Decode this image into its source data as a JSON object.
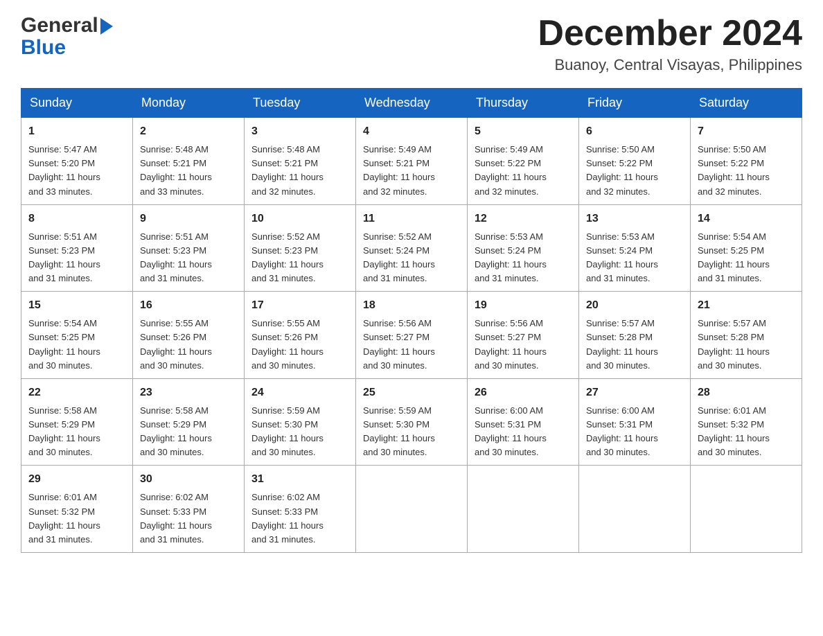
{
  "header": {
    "logo_general": "General",
    "logo_blue": "Blue",
    "month_title": "December 2024",
    "location": "Buanoy, Central Visayas, Philippines"
  },
  "weekdays": [
    "Sunday",
    "Monday",
    "Tuesday",
    "Wednesday",
    "Thursday",
    "Friday",
    "Saturday"
  ],
  "weeks": [
    [
      {
        "day": "1",
        "info": "Sunrise: 5:47 AM\nSunset: 5:20 PM\nDaylight: 11 hours\nand 33 minutes."
      },
      {
        "day": "2",
        "info": "Sunrise: 5:48 AM\nSunset: 5:21 PM\nDaylight: 11 hours\nand 33 minutes."
      },
      {
        "day": "3",
        "info": "Sunrise: 5:48 AM\nSunset: 5:21 PM\nDaylight: 11 hours\nand 32 minutes."
      },
      {
        "day": "4",
        "info": "Sunrise: 5:49 AM\nSunset: 5:21 PM\nDaylight: 11 hours\nand 32 minutes."
      },
      {
        "day": "5",
        "info": "Sunrise: 5:49 AM\nSunset: 5:22 PM\nDaylight: 11 hours\nand 32 minutes."
      },
      {
        "day": "6",
        "info": "Sunrise: 5:50 AM\nSunset: 5:22 PM\nDaylight: 11 hours\nand 32 minutes."
      },
      {
        "day": "7",
        "info": "Sunrise: 5:50 AM\nSunset: 5:22 PM\nDaylight: 11 hours\nand 32 minutes."
      }
    ],
    [
      {
        "day": "8",
        "info": "Sunrise: 5:51 AM\nSunset: 5:23 PM\nDaylight: 11 hours\nand 31 minutes."
      },
      {
        "day": "9",
        "info": "Sunrise: 5:51 AM\nSunset: 5:23 PM\nDaylight: 11 hours\nand 31 minutes."
      },
      {
        "day": "10",
        "info": "Sunrise: 5:52 AM\nSunset: 5:23 PM\nDaylight: 11 hours\nand 31 minutes."
      },
      {
        "day": "11",
        "info": "Sunrise: 5:52 AM\nSunset: 5:24 PM\nDaylight: 11 hours\nand 31 minutes."
      },
      {
        "day": "12",
        "info": "Sunrise: 5:53 AM\nSunset: 5:24 PM\nDaylight: 11 hours\nand 31 minutes."
      },
      {
        "day": "13",
        "info": "Sunrise: 5:53 AM\nSunset: 5:24 PM\nDaylight: 11 hours\nand 31 minutes."
      },
      {
        "day": "14",
        "info": "Sunrise: 5:54 AM\nSunset: 5:25 PM\nDaylight: 11 hours\nand 31 minutes."
      }
    ],
    [
      {
        "day": "15",
        "info": "Sunrise: 5:54 AM\nSunset: 5:25 PM\nDaylight: 11 hours\nand 30 minutes."
      },
      {
        "day": "16",
        "info": "Sunrise: 5:55 AM\nSunset: 5:26 PM\nDaylight: 11 hours\nand 30 minutes."
      },
      {
        "day": "17",
        "info": "Sunrise: 5:55 AM\nSunset: 5:26 PM\nDaylight: 11 hours\nand 30 minutes."
      },
      {
        "day": "18",
        "info": "Sunrise: 5:56 AM\nSunset: 5:27 PM\nDaylight: 11 hours\nand 30 minutes."
      },
      {
        "day": "19",
        "info": "Sunrise: 5:56 AM\nSunset: 5:27 PM\nDaylight: 11 hours\nand 30 minutes."
      },
      {
        "day": "20",
        "info": "Sunrise: 5:57 AM\nSunset: 5:28 PM\nDaylight: 11 hours\nand 30 minutes."
      },
      {
        "day": "21",
        "info": "Sunrise: 5:57 AM\nSunset: 5:28 PM\nDaylight: 11 hours\nand 30 minutes."
      }
    ],
    [
      {
        "day": "22",
        "info": "Sunrise: 5:58 AM\nSunset: 5:29 PM\nDaylight: 11 hours\nand 30 minutes."
      },
      {
        "day": "23",
        "info": "Sunrise: 5:58 AM\nSunset: 5:29 PM\nDaylight: 11 hours\nand 30 minutes."
      },
      {
        "day": "24",
        "info": "Sunrise: 5:59 AM\nSunset: 5:30 PM\nDaylight: 11 hours\nand 30 minutes."
      },
      {
        "day": "25",
        "info": "Sunrise: 5:59 AM\nSunset: 5:30 PM\nDaylight: 11 hours\nand 30 minutes."
      },
      {
        "day": "26",
        "info": "Sunrise: 6:00 AM\nSunset: 5:31 PM\nDaylight: 11 hours\nand 30 minutes."
      },
      {
        "day": "27",
        "info": "Sunrise: 6:00 AM\nSunset: 5:31 PM\nDaylight: 11 hours\nand 30 minutes."
      },
      {
        "day": "28",
        "info": "Sunrise: 6:01 AM\nSunset: 5:32 PM\nDaylight: 11 hours\nand 30 minutes."
      }
    ],
    [
      {
        "day": "29",
        "info": "Sunrise: 6:01 AM\nSunset: 5:32 PM\nDaylight: 11 hours\nand 31 minutes."
      },
      {
        "day": "30",
        "info": "Sunrise: 6:02 AM\nSunset: 5:33 PM\nDaylight: 11 hours\nand 31 minutes."
      },
      {
        "day": "31",
        "info": "Sunrise: 6:02 AM\nSunset: 5:33 PM\nDaylight: 11 hours\nand 31 minutes."
      },
      {
        "day": "",
        "info": ""
      },
      {
        "day": "",
        "info": ""
      },
      {
        "day": "",
        "info": ""
      },
      {
        "day": "",
        "info": ""
      }
    ]
  ]
}
